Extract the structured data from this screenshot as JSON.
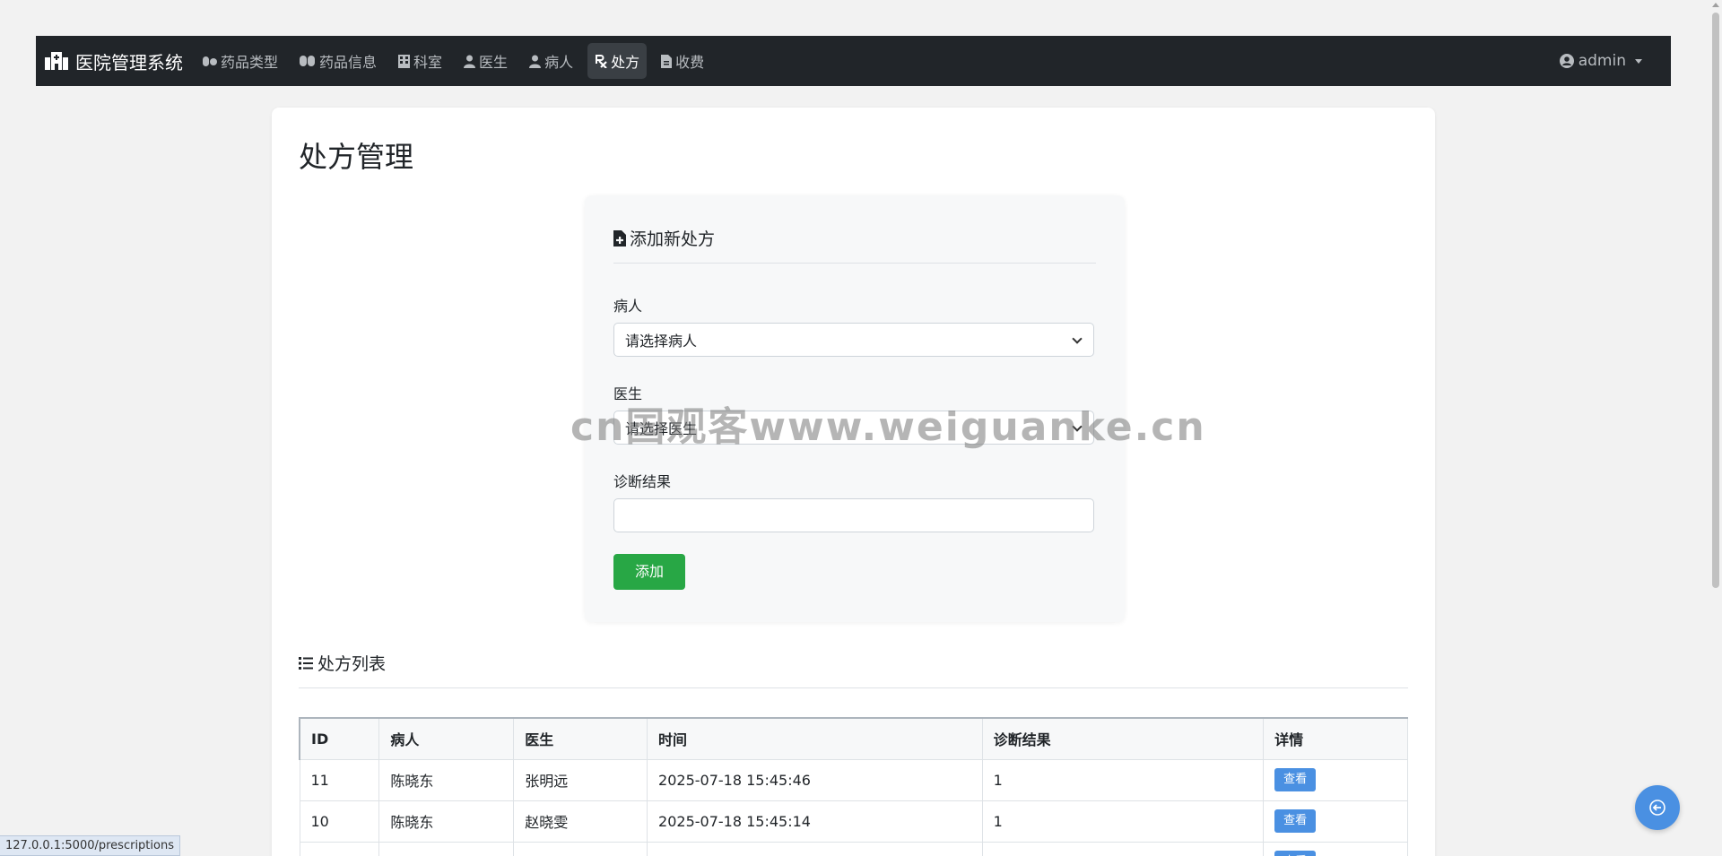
{
  "navbar": {
    "brand": "医院管理系统",
    "items": [
      {
        "label": "药品类型",
        "icon": "pills-icon"
      },
      {
        "label": "药品信息",
        "icon": "capsules-icon"
      },
      {
        "label": "科室",
        "icon": "building-icon"
      },
      {
        "label": "医生",
        "icon": "user-doctor-icon"
      },
      {
        "label": "病人",
        "icon": "user-injured-icon"
      },
      {
        "label": "处方",
        "icon": "prescription-icon",
        "active": true
      },
      {
        "label": "收费",
        "icon": "invoice-icon"
      }
    ],
    "user": "admin"
  },
  "page": {
    "title": "处方管理"
  },
  "form": {
    "heading": "添加新处方",
    "patient_label": "病人",
    "patient_value": "请选择病人",
    "doctor_label": "医生",
    "doctor_value": "请选择医生",
    "diagnosis_label": "诊断结果",
    "diagnosis_value": "",
    "submit_label": "添加"
  },
  "list": {
    "heading": "处方列表",
    "columns": [
      "ID",
      "病人",
      "医生",
      "时间",
      "诊断结果",
      "详情"
    ],
    "rows": [
      {
        "id": "11",
        "patient": "陈晓东",
        "doctor": "张明远",
        "time": "2025-07-18 15:45:46",
        "diagnosis": "1",
        "action": "查看"
      },
      {
        "id": "10",
        "patient": "陈晓东",
        "doctor": "赵晓雯",
        "time": "2025-07-18 15:45:14",
        "diagnosis": "1",
        "action": "查看"
      },
      {
        "id": "",
        "patient": "",
        "doctor": "",
        "time": "",
        "diagnosis": "",
        "action": "查看"
      }
    ]
  },
  "watermark": "cn国观客www.weiguanke.cn",
  "status_url": "127.0.0.1:5000/prescriptions",
  "colors": {
    "navbar": "#212529",
    "success": "#28a745",
    "primary": "#4a90e2"
  }
}
